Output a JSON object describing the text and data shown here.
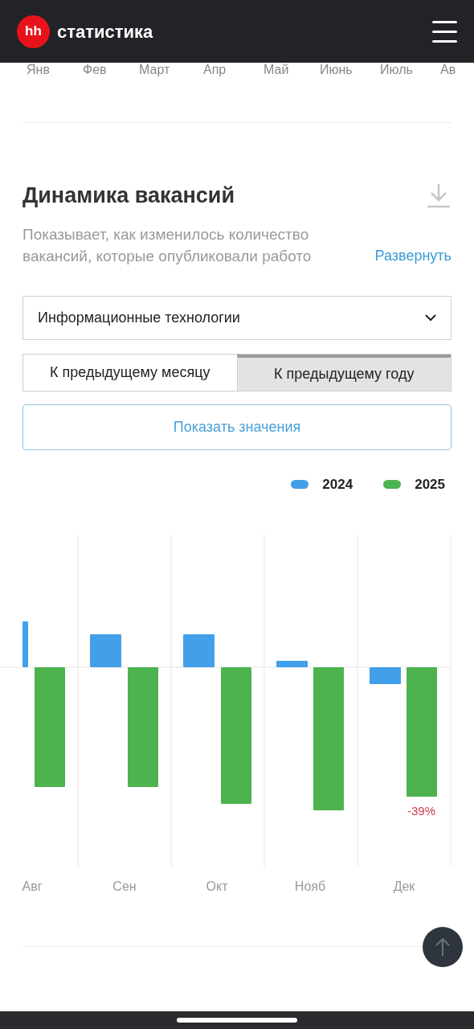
{
  "header": {
    "logo": "hh",
    "title": "статистика"
  },
  "previous_chart": {
    "months": [
      "Янв",
      "Фев",
      "Март",
      "Апр",
      "Май",
      "Июнь",
      "Июль",
      "Ав"
    ]
  },
  "section": {
    "title": "Динамика вакансий",
    "description": "Показывает, как изменилось количество вакансий, которые опубликовали работо",
    "expand_link": "Развернуть"
  },
  "industry_select": {
    "value": "Информационные технологии"
  },
  "tabs": [
    {
      "label": "К предыдущему месяцу",
      "selected": false
    },
    {
      "label": "К предыдущему году",
      "selected": true
    }
  ],
  "show_values_button": "Показать значения",
  "legend": [
    {
      "label": "2024",
      "color": "#42a0eb"
    },
    {
      "label": "2025",
      "color": "#4cb34f"
    }
  ],
  "chart": {
    "months": [
      "Авг",
      "Сен",
      "Окт",
      "Нояб",
      "Дек"
    ],
    "annotation": "-39%"
  }
}
